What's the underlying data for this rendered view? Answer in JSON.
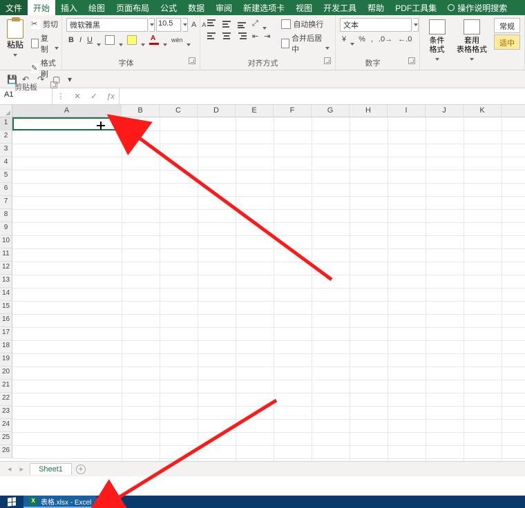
{
  "tabs": {
    "file": "文件",
    "home": "开始",
    "insert": "插入",
    "draw": "绘图",
    "layout": "页面布局",
    "formulas": "公式",
    "data": "数据",
    "review": "审阅",
    "newtab": "新建选项卡",
    "view": "视图",
    "dev": "开发工具",
    "help": "帮助",
    "pdf": "PDF工具集",
    "tell_me": "操作说明搜索"
  },
  "clipboard": {
    "paste": "粘贴",
    "cut": "剪切",
    "copy": "复制",
    "format_painter": "格式刷",
    "group": "剪贴板"
  },
  "font": {
    "name": "微软雅黑",
    "size": "10.5",
    "bold": "B",
    "italic": "I",
    "underline": "U",
    "group": "字体"
  },
  "align": {
    "wrap": "自动换行",
    "merge": "合并后居中",
    "group": "对齐方式"
  },
  "number": {
    "format": "文本",
    "percent": "%",
    "comma": ",",
    "group": "数字"
  },
  "styles": {
    "cond": "条件格式",
    "table": "套用\n表格格式",
    "normal": "常规",
    "good": "适中"
  },
  "namebox": "A1",
  "columns": [
    "A",
    "B",
    "C",
    "D",
    "E",
    "F",
    "G",
    "H",
    "I",
    "J",
    "K"
  ],
  "rows": [
    "1",
    "2",
    "3",
    "4",
    "5",
    "6",
    "7",
    "8",
    "9",
    "10",
    "11",
    "12",
    "13",
    "14",
    "15",
    "16",
    "17",
    "18",
    "19",
    "20",
    "21",
    "22",
    "23",
    "24",
    "25",
    "26"
  ],
  "sheet_tab": "Sheet1",
  "taskbar_item": "表格.xlsx - Excel",
  "xls_icon": "X"
}
